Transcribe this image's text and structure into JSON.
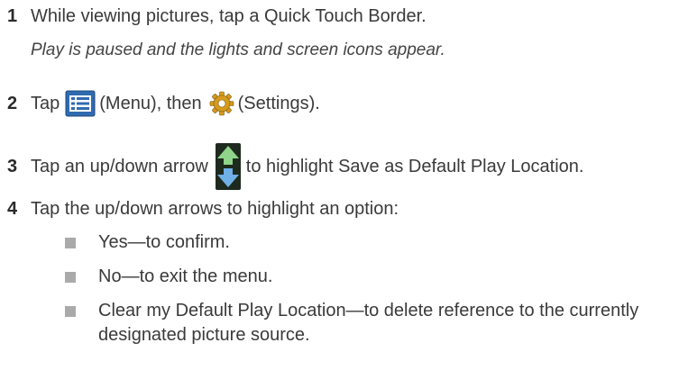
{
  "steps": [
    {
      "num": "1",
      "text": "While viewing pictures, tap a Quick Touch Border.",
      "note": "Play is paused and the lights and screen icons appear."
    },
    {
      "num": "2",
      "pre": "Tap",
      "icon1_label": "(Menu), then",
      "icon2_label": "(Settings)."
    },
    {
      "num": "3",
      "pre": "Tap an up/down arrow",
      "post": "to highlight Save as Default Play Location."
    },
    {
      "num": "4",
      "text": "Tap the up/down arrows to highlight an option:"
    }
  ],
  "options": [
    "Yes—to confirm.",
    "No—to exit the menu.",
    "Clear my Default Play Location—to delete reference to the currently designated picture source."
  ],
  "icons": {
    "menu": "menu-icon",
    "settings": "gear-icon",
    "updown": "up-down-arrow-icon"
  },
  "colors": {
    "menu_blue": "#2f6bb0",
    "bullet_gray": "#aaaaaa"
  }
}
